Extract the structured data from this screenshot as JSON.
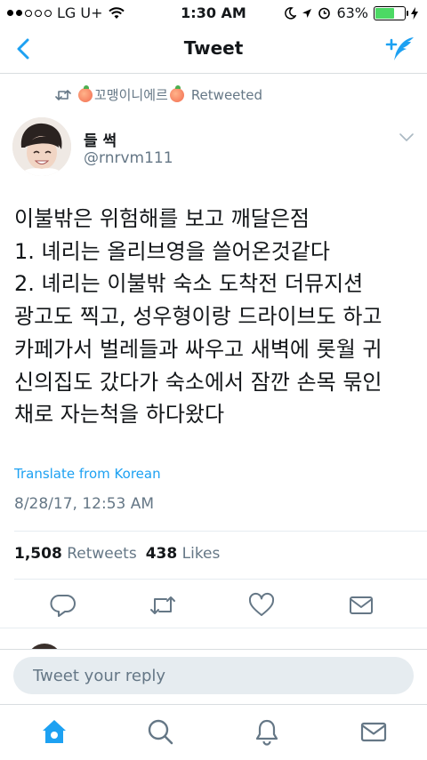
{
  "status_bar": {
    "carrier": "LG U+",
    "time": "1:30 AM",
    "battery_percent": "63%",
    "battery_level": 0.63,
    "signal_bars_filled": 2,
    "signal_bars_total": 5
  },
  "nav": {
    "title": "Tweet",
    "back_icon": "chevron-left-icon",
    "compose_icon": "compose-tweet-icon",
    "accent_color": "#1da1f2"
  },
  "retweeted_by": {
    "name": "꼬맹이니에르",
    "label": "Retweeted"
  },
  "author": {
    "display_name": "들 썩",
    "handle": "@rnrvm111"
  },
  "tweet": {
    "lines": [
      "이불밖은 위험해를 보고 깨달은점",
      "1. 녜리는 올리브영을 쓸어온것같다",
      "2. 녜리는 이불밖 숙소 도착전 더뮤지션",
      "광고도 찍고, 성우형이랑 드라이브도 하고",
      "카페가서 벌레들과 싸우고 새벽에 롯월 귀",
      "신의집도 갔다가 숙소에서 잠깐 손목 묶인",
      "채로 자는척을 하다왔다"
    ],
    "translate_label": "Translate from Korean",
    "timestamp": "8/28/17, 12:53 AM"
  },
  "stats": {
    "retweets_count": "1,508",
    "retweets_label": "Retweets",
    "likes_count": "438",
    "likes_label": "Likes"
  },
  "actions": [
    "reply-icon",
    "retweet-icon",
    "like-heart-icon",
    "direct-message-icon"
  ],
  "reply": {
    "placeholder": "Tweet your reply"
  },
  "tabbar": [
    "home-icon",
    "search-icon",
    "notifications-bell-icon",
    "messages-envelope-icon"
  ],
  "colors": {
    "accent": "#1da1f2",
    "secondary_text": "#657786",
    "battery_green": "#4cd964"
  }
}
